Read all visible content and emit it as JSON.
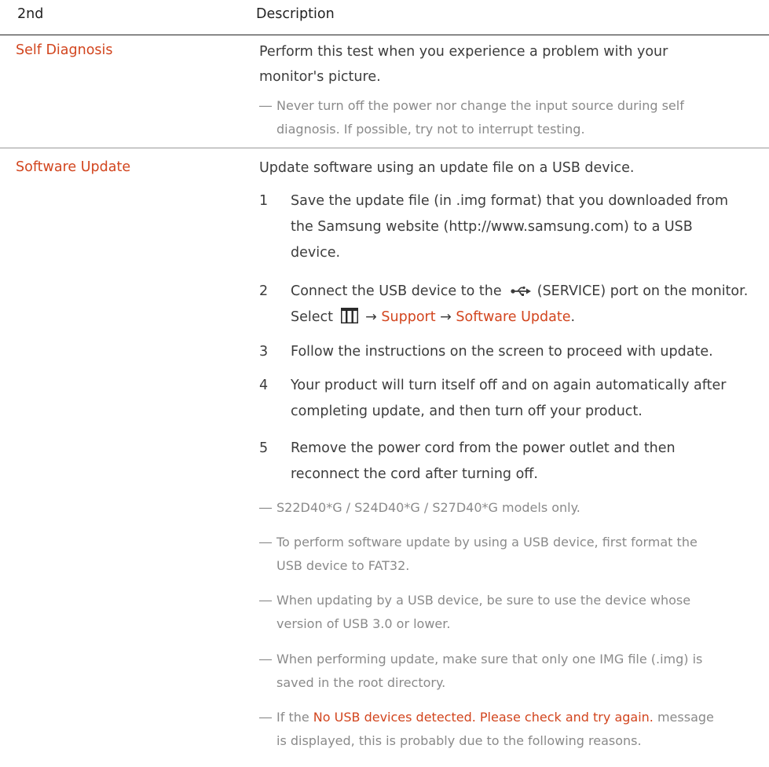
{
  "header": {
    "col1": "2nd",
    "col2": "Description"
  },
  "rows": [
    {
      "name": "Self Diagnosis",
      "description": "Perform this test when you experience a problem with your monitor's picture.",
      "desc_line1": "Perform this test when you experience a problem with your",
      "desc_line2": "monitor's picture.",
      "notes": [
        {
          "line1": "Never turn off the power nor change the input source during self",
          "line2": "diagnosis. If possible, try not to interrupt testing."
        }
      ]
    },
    {
      "name": "Software Update",
      "description": "Update software using an update file on a USB device.",
      "steps": [
        {
          "num": "1",
          "line1": "Save the update file (in .img format) that you downloaded from",
          "line2": "the Samsung website (http://www.samsung.com) to a USB",
          "line3": "device."
        },
        {
          "num": "2",
          "line1_pre": "Connect the USB device to the",
          "line1_service": "(SERVICE)",
          "line1_post": "port on the monitor.",
          "line2_pre": "Select",
          "arrow1": "→",
          "support": "Support",
          "arrow2": "→",
          "software_update": "Software Update",
          "period": "."
        },
        {
          "num": "3",
          "line1": "Follow the instructions on the screen to proceed with update."
        },
        {
          "num": "4",
          "line1": "Your product will turn itself off and on again automatically after",
          "line2": "completing update, and then turn off your product."
        },
        {
          "num": "5",
          "line1": "Remove the power cord from the power outlet and then",
          "line2": "reconnect the cord after turning off."
        }
      ],
      "notes": [
        {
          "line1": "S22D40*G / S24D40*G / S27D40*G models only."
        },
        {
          "line1": "To perform software update by using a USB device, first format the",
          "line2": "USB device to FAT32."
        },
        {
          "line1": "When updating by a USB device, be sure to use the device whose",
          "line2": "version of USB 3.0 or lower."
        },
        {
          "line1": "When performing update, make sure that only one IMG file (.img) is",
          "line2": "saved in the root directory."
        },
        {
          "line1_pre": "If the",
          "line1_red": "No USB devices detected. Please check and try again.",
          "line1_post": "message",
          "line2": "is displayed, this is probably due to the following reasons."
        }
      ]
    }
  ],
  "note_dash": "―",
  "icons": {
    "usb": "usb-icon",
    "menu": "menu-icon"
  },
  "colors": {
    "accent": "#d2451e",
    "text": "#3c3c3c",
    "note": "#8a8a8a"
  }
}
